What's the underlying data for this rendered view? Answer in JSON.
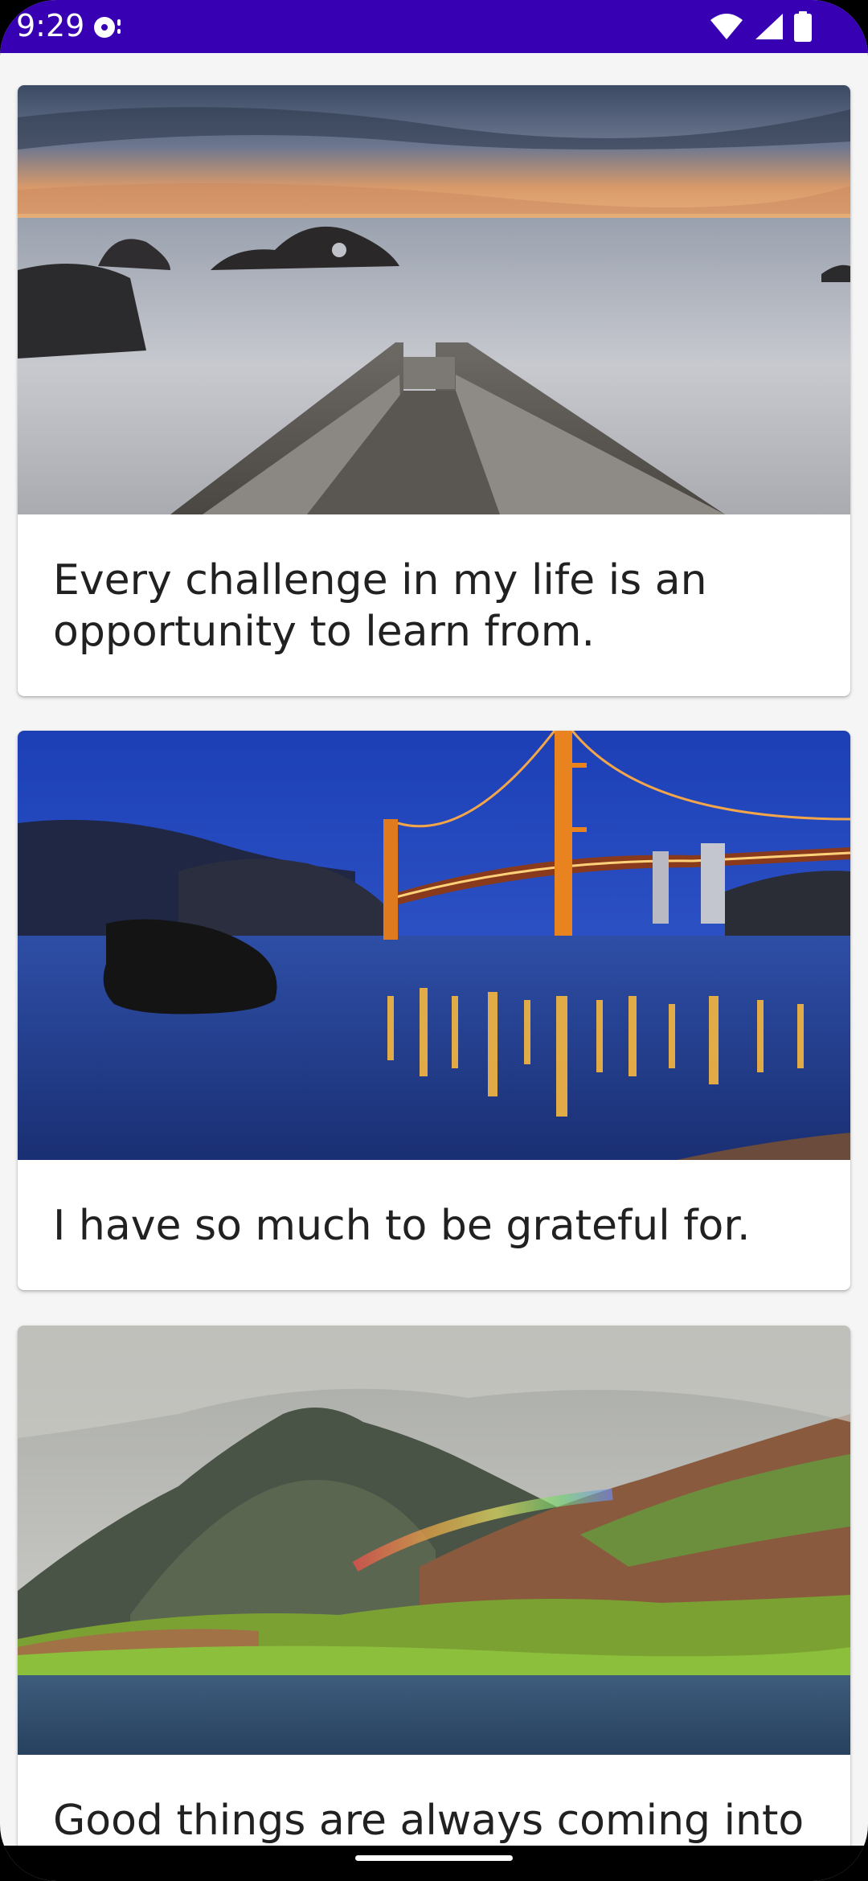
{
  "status_bar": {
    "time": "9:29",
    "color": "#3700B3",
    "icons": [
      "media-notification-icon",
      "wifi-icon",
      "cellular-signal-icon",
      "battery-icon"
    ]
  },
  "cards": [
    {
      "text": "Every challenge in my life is an opportunity to learn from.",
      "image": "ocean-pier-sunset-photo"
    },
    {
      "text": "I have so much to be grateful for.",
      "image": "golden-gate-bridge-night-photo"
    },
    {
      "text": "Good things are always coming into",
      "image": "mountain-rainbow-coast-photo"
    }
  ],
  "colors": {
    "background": "#F5F5F5",
    "card": "#FFFFFF",
    "text": "#212121"
  }
}
